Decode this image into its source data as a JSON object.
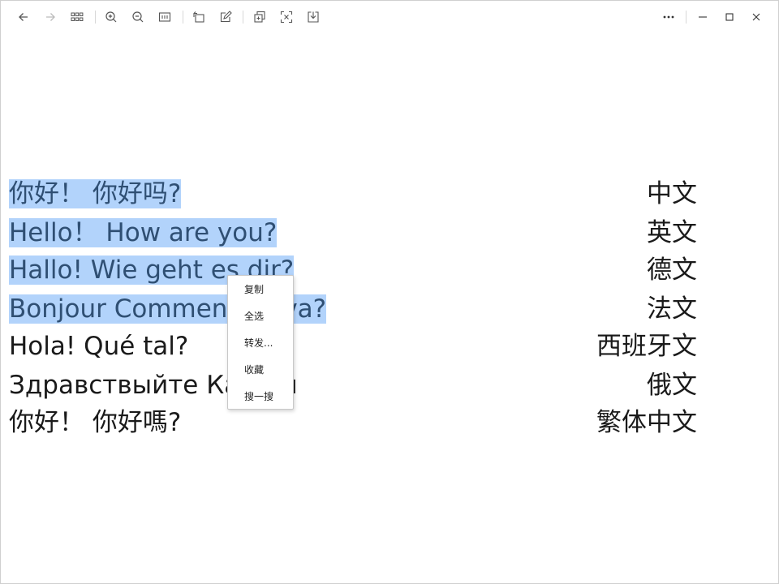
{
  "toolbar": {
    "icons": [
      "back-arrow-icon",
      "forward-arrow-icon",
      "grid-icon",
      "zoom-in-icon",
      "zoom-out-icon",
      "fit-width-icon",
      "rotate-icon",
      "edit-icon",
      "copy-icon",
      "text-extract-icon",
      "download-icon"
    ],
    "window_controls": [
      "more-icon",
      "minimize-icon",
      "maximize-icon",
      "close-icon"
    ]
  },
  "lines": [
    {
      "text": "你好！ 你好吗?",
      "lang": "中文",
      "selected": true
    },
    {
      "text": "Hello！ How are you?",
      "lang": "英文",
      "selected": true
    },
    {
      "text": "Hallo! Wie geht es dir?",
      "lang": "德文",
      "selected": true
    },
    {
      "text": "Bonjour Comment ça va?",
      "lang": "法文",
      "selected": true
    },
    {
      "text": "Hola! Qué tal?",
      "lang": "西班牙文",
      "selected": false
    },
    {
      "text": "Здравствыйте Как вы",
      "lang": "俄文",
      "selected": false
    },
    {
      "text": "你好！  你好嗎?",
      "lang": "繁体中文",
      "selected": false
    }
  ],
  "context_menu": {
    "items": [
      "复制",
      "全选",
      "转发...",
      "收藏",
      "搜一搜"
    ]
  },
  "colors": {
    "selection": "#b2d3fb",
    "selected_text": "#2f4f73",
    "text": "#1a1a1a"
  }
}
